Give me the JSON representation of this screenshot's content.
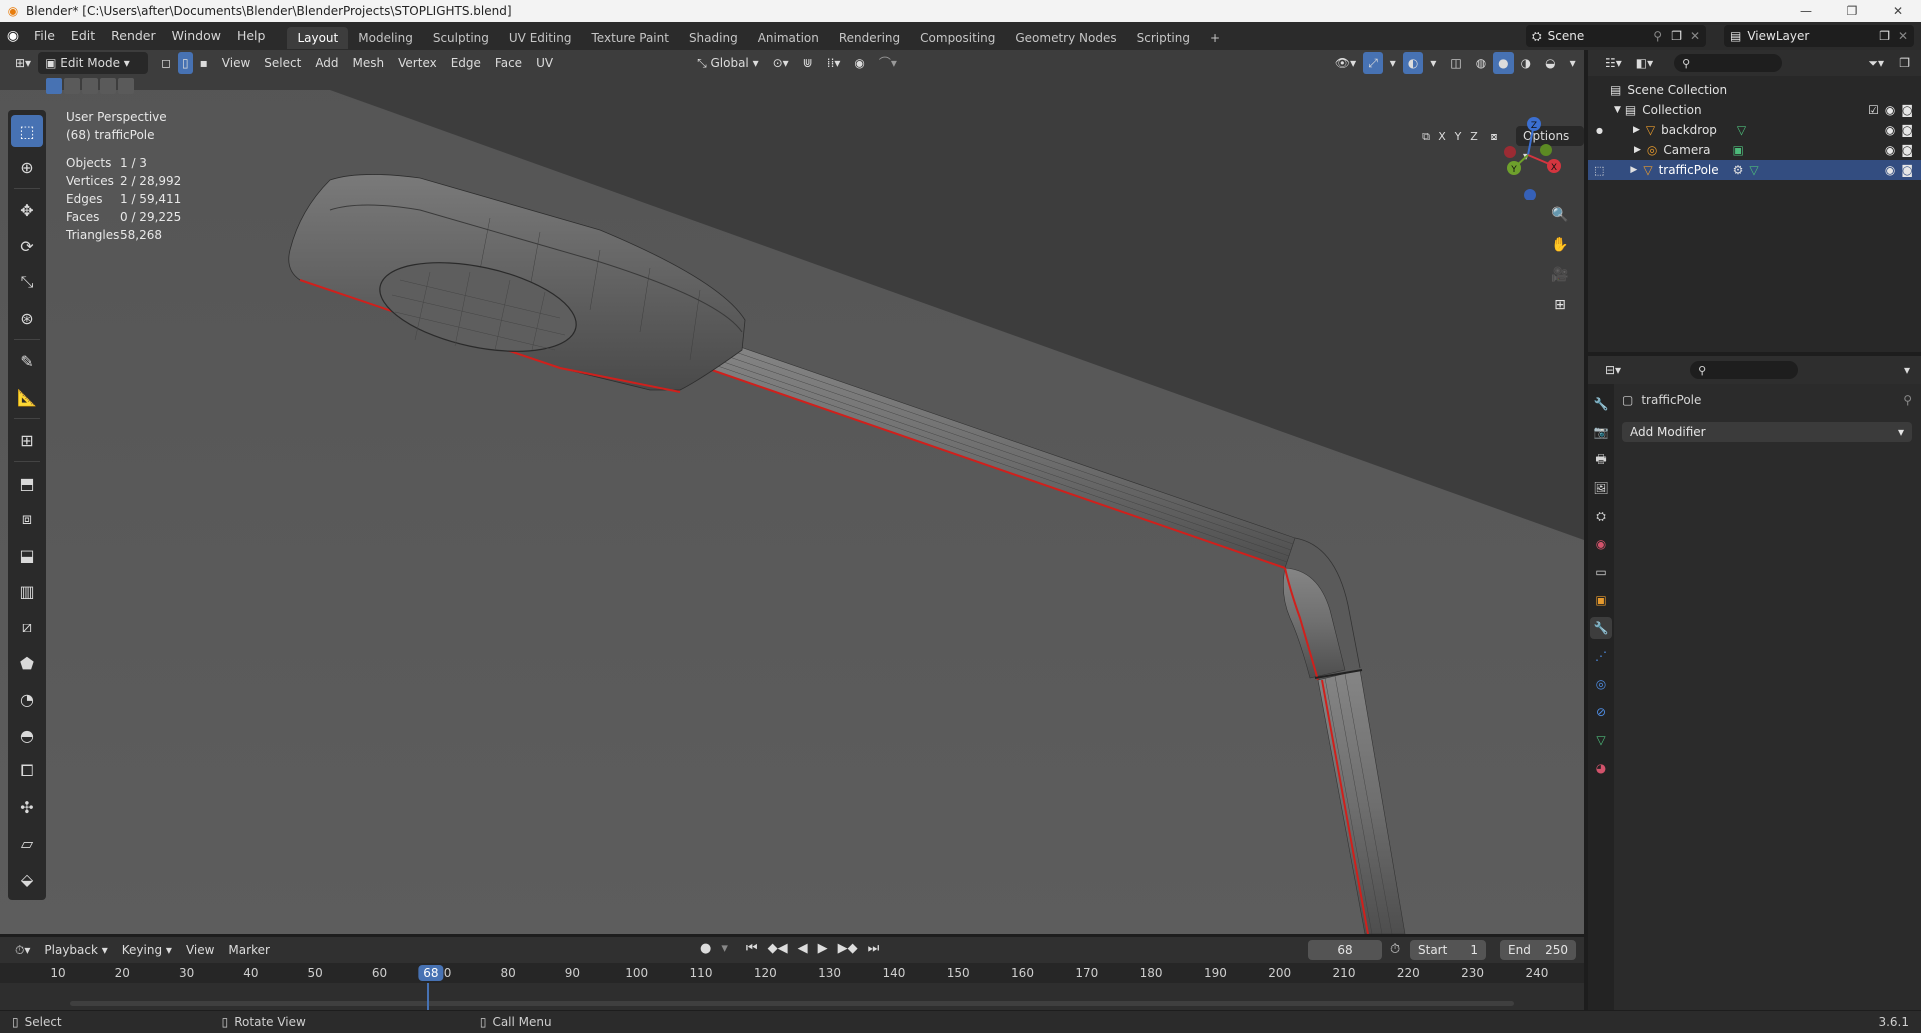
{
  "window": {
    "title": "Blender* [C:\\Users\\after\\Documents\\Blender\\BlenderProjects\\STOPLIGHTS.blend]"
  },
  "menus": [
    "File",
    "Edit",
    "Render",
    "Window",
    "Help"
  ],
  "workspaces": {
    "active": "Layout",
    "tabs": [
      "Layout",
      "Modeling",
      "Sculpting",
      "UV Editing",
      "Texture Paint",
      "Shading",
      "Animation",
      "Rendering",
      "Compositing",
      "Geometry Nodes",
      "Scripting"
    ]
  },
  "scene": {
    "name": "Scene",
    "view_layer": "ViewLayer"
  },
  "viewport_header": {
    "mode": "Edit Mode",
    "menus": [
      "View",
      "Select",
      "Add",
      "Mesh",
      "Vertex",
      "Edge",
      "Face",
      "UV"
    ],
    "orientation": "Global",
    "options_label": "Options"
  },
  "viewport_overlay": {
    "view_name": "User Perspective",
    "object_label": "(68) trafficPole",
    "stats": [
      {
        "key": "Objects",
        "value": "1 / 3"
      },
      {
        "key": "Vertices",
        "value": "2 / 28,992"
      },
      {
        "key": "Edges",
        "value": "1 / 59,411"
      },
      {
        "key": "Faces",
        "value": "0 / 29,225"
      },
      {
        "key": "Triangles",
        "value": "58,268"
      }
    ],
    "axes": [
      "X",
      "Y",
      "Z"
    ]
  },
  "outliner": {
    "root": "Scene Collection",
    "collection": "Collection",
    "items": [
      {
        "name": "backdrop",
        "selected": false
      },
      {
        "name": "Camera",
        "selected": false
      },
      {
        "name": "trafficPole",
        "selected": true
      }
    ]
  },
  "properties": {
    "object_name": "trafficPole",
    "add_modifier_label": "Add Modifier"
  },
  "timeline": {
    "menus": [
      "Playback",
      "Keying",
      "View",
      "Marker"
    ],
    "current_frame": "68",
    "start_label": "Start",
    "start_value": "1",
    "end_label": "End",
    "end_value": "250",
    "ruler_ticks": [
      "10",
      "20",
      "30",
      "40",
      "50",
      "60",
      "70",
      "80",
      "90",
      "100",
      "110",
      "120",
      "130",
      "140",
      "150",
      "160",
      "170",
      "180",
      "190",
      "200",
      "210",
      "220",
      "230",
      "240"
    ]
  },
  "statusbar": {
    "select": "Select",
    "rotate": "Rotate View",
    "menu": "Call Menu",
    "version": "3.6.1"
  },
  "colors": {
    "selection_blue": "#4772b3",
    "outliner_selected": "#334d80",
    "seam_red": "#d0201c",
    "viewport_bg": "#4f4f4f"
  }
}
